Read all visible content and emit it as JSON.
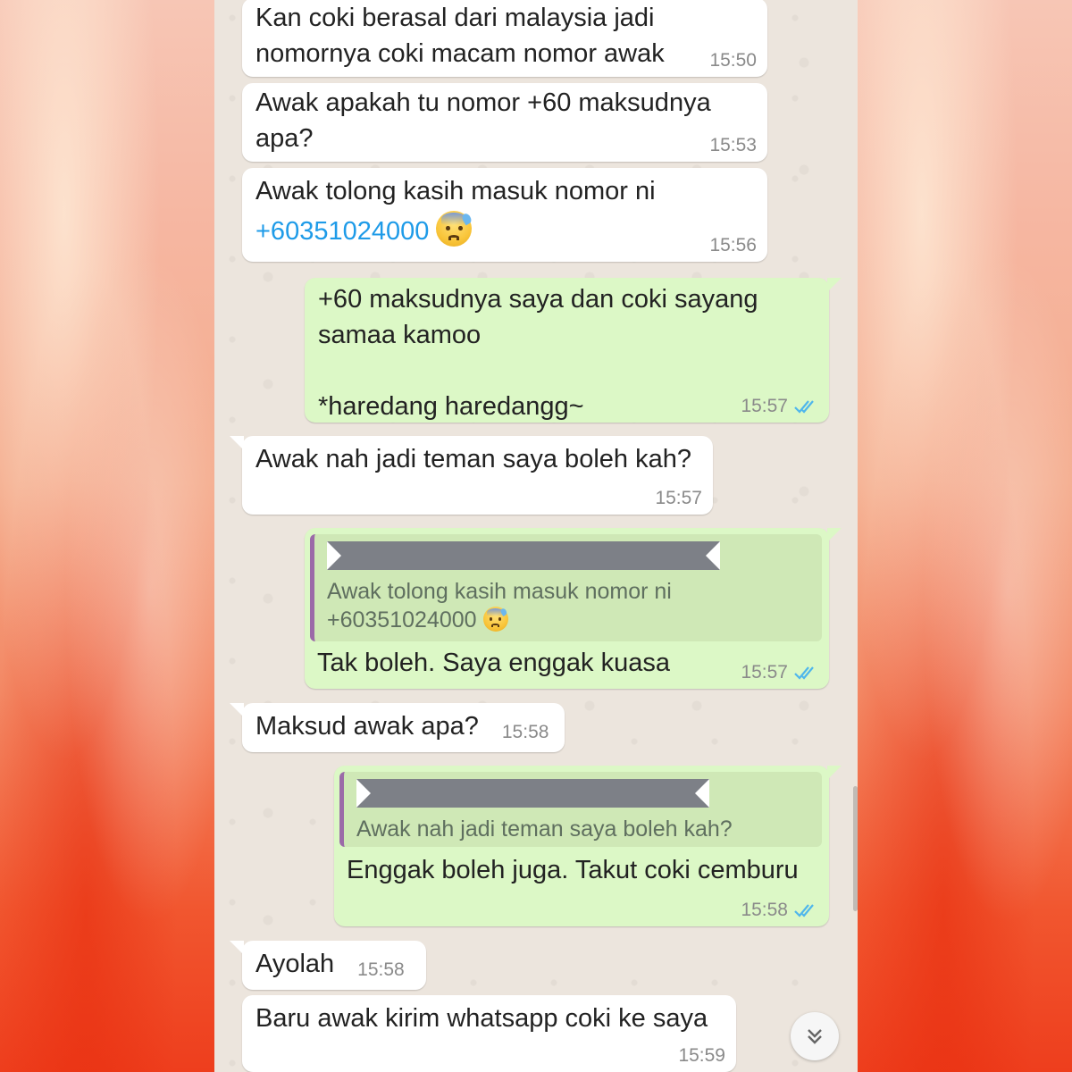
{
  "messages": [
    {
      "id": "m1",
      "dir": "in",
      "lines": "Kan coki berasal dari malaysia jadi\nnomornya coki macam nomor awak",
      "time": "15:50"
    },
    {
      "id": "m2",
      "dir": "in",
      "lines": "Awak apakah tu nomor +60 maksudnya\napa?",
      "time": "15:53"
    },
    {
      "id": "m3",
      "dir": "in",
      "text": "Awak tolong kasih masuk nomor ni",
      "link": "+60351024000",
      "emoji": "anxious-face-with-sweat",
      "time": "15:56"
    },
    {
      "id": "m4",
      "dir": "out",
      "lines": "+60 maksudnya saya dan coki sayang\nsamaa kamoo\n\n*haredang haredangg~",
      "time": "15:57",
      "status": "read"
    },
    {
      "id": "m5",
      "dir": "in",
      "lines": "Awak nah jadi teman saya boleh kah?",
      "time": "15:57"
    },
    {
      "id": "m6",
      "dir": "out",
      "quote": {
        "line1": "Awak tolong kasih masuk nomor ni",
        "line2": "+60351024000",
        "emoji": "anxious-face-with-sweat"
      },
      "lines": "Tak boleh. Saya enggak kuasa",
      "time": "15:57",
      "status": "read"
    },
    {
      "id": "m7",
      "dir": "in",
      "lines": "Maksud awak apa?",
      "time": "15:58"
    },
    {
      "id": "m8",
      "dir": "out",
      "quote": {
        "line1": "Awak nah jadi teman saya boleh kah?"
      },
      "lines": "Enggak boleh juga. Takut coki cemburu",
      "time": "15:58",
      "status": "read"
    },
    {
      "id": "m9",
      "dir": "in",
      "lines": "Ayolah",
      "time": "15:58"
    },
    {
      "id": "m10",
      "dir": "in",
      "lines": "Baru awak kirim whatsapp coki ke saya",
      "time": "15:59"
    }
  ],
  "colors": {
    "incoming": "#ffffff",
    "outgoing": "#dcf8c6",
    "chat_bg": "#ece5dd",
    "link": "#1e9be8",
    "read_ticks": "#4fb6ec"
  },
  "icons": {
    "read_receipt": "double-check-icon",
    "scroll_down": "chevron-down-double-icon"
  }
}
